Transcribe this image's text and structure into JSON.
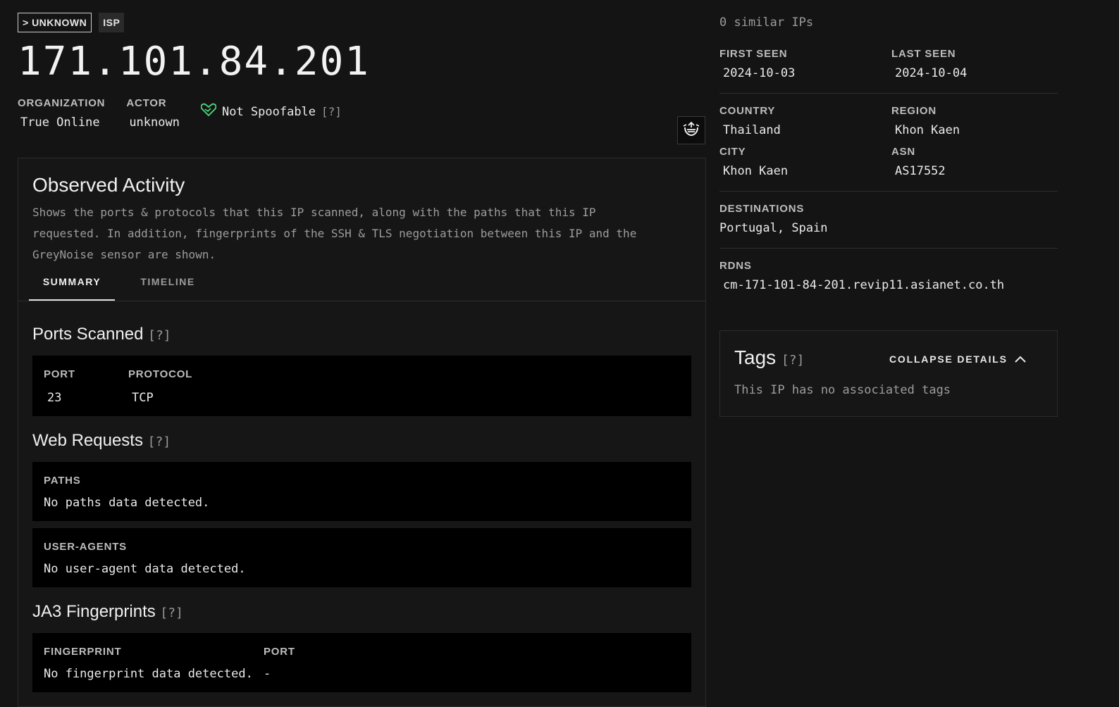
{
  "header": {
    "classification_badge": "> UNKNOWN",
    "type_badge": "ISP",
    "ip": "171.101.84.201"
  },
  "meta": {
    "organization_label": "ORGANIZATION",
    "organization_value": "True Online",
    "actor_label": "ACTOR",
    "actor_value": "unknown",
    "spoofable_text": "Not Spoofable",
    "help_marker": "[?]",
    "spoof_icon_color": "#4ade80"
  },
  "activity": {
    "title": "Observed Activity",
    "description": "Shows the ports & protocols that this IP scanned, along with the paths that this IP requested. In addition, fingerprints of the SSH & TLS negotiation between this IP and the GreyNoise sensor are shown.",
    "tabs": [
      {
        "label": "SUMMARY",
        "active": true
      },
      {
        "label": "TIMELINE",
        "active": false
      }
    ],
    "ports": {
      "title": "Ports Scanned",
      "help": "[?]",
      "columns": [
        "PORT",
        "PROTOCOL"
      ],
      "rows": [
        [
          "23",
          "TCP"
        ]
      ]
    },
    "web": {
      "title": "Web Requests",
      "help": "[?]",
      "paths_label": "PATHS",
      "paths_value": "No paths data detected.",
      "ua_label": "USER-AGENTS",
      "ua_value": "No user-agent data detected."
    },
    "ja3": {
      "title": "JA3 Fingerprints",
      "help": "[?]",
      "columns": [
        "FINGERPRINT",
        "PORT"
      ],
      "rows": [
        [
          "No fingerprint data detected.",
          "-"
        ]
      ]
    }
  },
  "sidebar": {
    "similar": "0 similar IPs",
    "first_seen_label": "FIRST SEEN",
    "first_seen_value": "2024-10-03",
    "last_seen_label": "LAST SEEN",
    "last_seen_value": "2024-10-04",
    "country_label": "COUNTRY",
    "country_value": "Thailand",
    "region_label": "REGION",
    "region_value": "Khon Kaen",
    "city_label": "CITY",
    "city_value": "Khon Kaen",
    "asn_label": "ASN",
    "asn_value": "AS17552",
    "destinations_label": "DESTINATIONS",
    "destinations_value": "Portugal, Spain",
    "rdns_label": "RDNS",
    "rdns_value": "cm-171-101-84-201.revip11.asianet.co.th"
  },
  "tags": {
    "title": "Tags",
    "help": "[?]",
    "collapse_label": "COLLAPSE DETAILS",
    "empty_text": "This IP has no associated tags"
  }
}
